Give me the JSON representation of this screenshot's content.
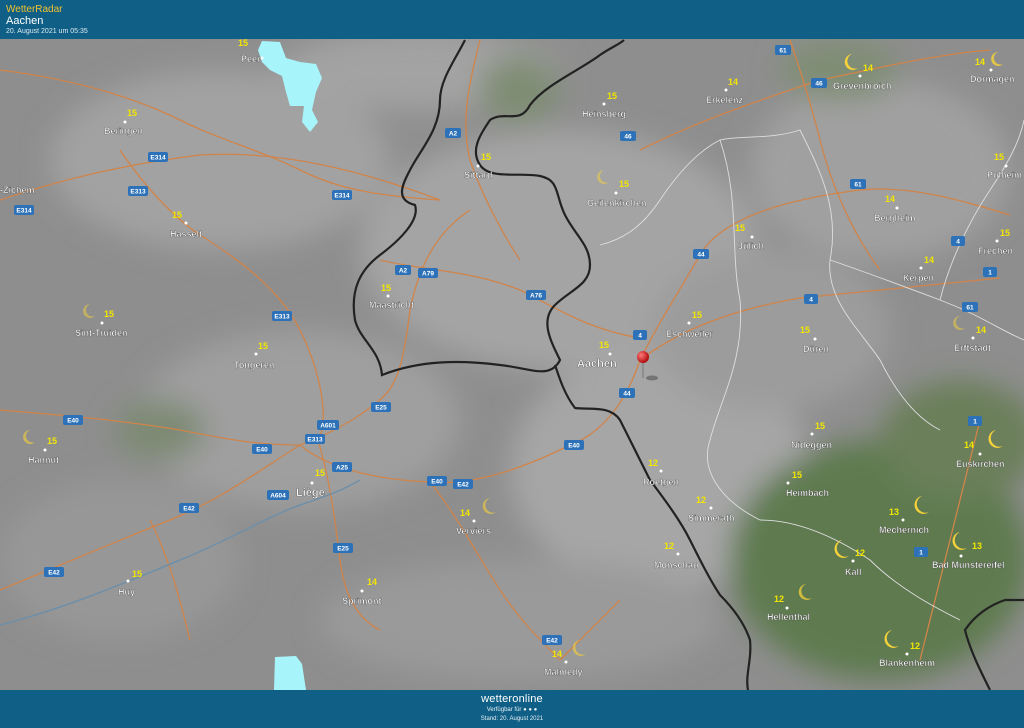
{
  "header": {
    "brand": "WetterRadar",
    "location": "Aachen",
    "timestamp": "20. August 2021 um 05:35"
  },
  "footer": {
    "brand": "wetteronline",
    "availability": "Verfügbar für ● ● ●",
    "stand": "Stand: 20. August 2021"
  },
  "colors": {
    "header_bg": "#0f5f86",
    "brand_accent": "#f2c230",
    "temperature_text": "#f2e600",
    "road": "#d0844a",
    "border": "#222222",
    "radar_light": "#a8f4fb",
    "marker": "#d81818"
  },
  "cities": [
    {
      "name": "Peer",
      "temp": "15"
    },
    {
      "name": "Beringen",
      "temp": "15"
    },
    {
      "name": "Hasselt",
      "temp": "15"
    },
    {
      "name": "Sint-Truiden",
      "temp": "15"
    },
    {
      "name": "Tongeren",
      "temp": "15"
    },
    {
      "name": "Hannut",
      "temp": "15"
    },
    {
      "name": "Huy",
      "temp": "15"
    },
    {
      "name": "Liège",
      "temp": "15"
    },
    {
      "name": "Sprimont",
      "temp": "14"
    },
    {
      "name": "Verviers",
      "temp": "14"
    },
    {
      "name": "Malmedy",
      "temp": "14"
    },
    {
      "name": "Maastricht",
      "temp": "15"
    },
    {
      "name": "Sittard",
      "temp": "15"
    },
    {
      "name": "Heinsberg",
      "temp": "15"
    },
    {
      "name": "Erkelenz",
      "temp": "14"
    },
    {
      "name": "Geilenkirchen",
      "temp": "15"
    },
    {
      "name": "Jülich",
      "temp": "15"
    },
    {
      "name": "Aachen",
      "temp": "15"
    },
    {
      "name": "Eschweiler",
      "temp": "15"
    },
    {
      "name": "Düren",
      "temp": "15"
    },
    {
      "name": "Roetgen",
      "temp": "12"
    },
    {
      "name": "Simmerath",
      "temp": "12"
    },
    {
      "name": "Monschau",
      "temp": "12"
    },
    {
      "name": "Nideggen",
      "temp": "15"
    },
    {
      "name": "Heimbach",
      "temp": "15"
    },
    {
      "name": "Hellenthal",
      "temp": "12"
    },
    {
      "name": "Grevenbroich",
      "temp": "14"
    },
    {
      "name": "Dormagen",
      "temp": "14"
    },
    {
      "name": "Bergheim",
      "temp": "14"
    },
    {
      "name": "Pulheim",
      "temp": "15"
    },
    {
      "name": "Kerpen",
      "temp": "14"
    },
    {
      "name": "Frechen",
      "temp": "15"
    },
    {
      "name": "Erftstadt",
      "temp": "14"
    },
    {
      "name": "Euskirchen",
      "temp": "14"
    },
    {
      "name": "Mechernich",
      "temp": "13"
    },
    {
      "name": "Kall",
      "temp": "12"
    },
    {
      "name": "Bad Munstereifel",
      "temp": "13"
    },
    {
      "name": "Blankenheim",
      "temp": "12"
    }
  ],
  "partial_labels": {
    "zichem": "-Zichem"
  },
  "roads": {
    "e314a": "E314",
    "e314b": "E314",
    "e314c": "E314",
    "e313a": "E313",
    "e313b": "E313",
    "e313c": "E313",
    "a2a": "A2",
    "a2b": "A2",
    "a79": "A79",
    "a76": "A76",
    "e25a": "E25",
    "e25b": "E25",
    "e40a": "E40",
    "e40b": "E40",
    "e40c": "E40",
    "e40d": "E40",
    "a601": "A601",
    "a25": "A25",
    "a604": "A604",
    "e42a": "E42",
    "e42b": "E42",
    "e42c": "E42",
    "e42d": "E42",
    "r4a": "4",
    "r4b": "4",
    "r4c": "4",
    "r44a": "44",
    "r44b": "44",
    "r46a": "46",
    "r46b": "46",
    "r61a": "61",
    "r61b": "61",
    "r61c": "61",
    "r1a": "1",
    "r1b": "1",
    "r1c": "1"
  }
}
